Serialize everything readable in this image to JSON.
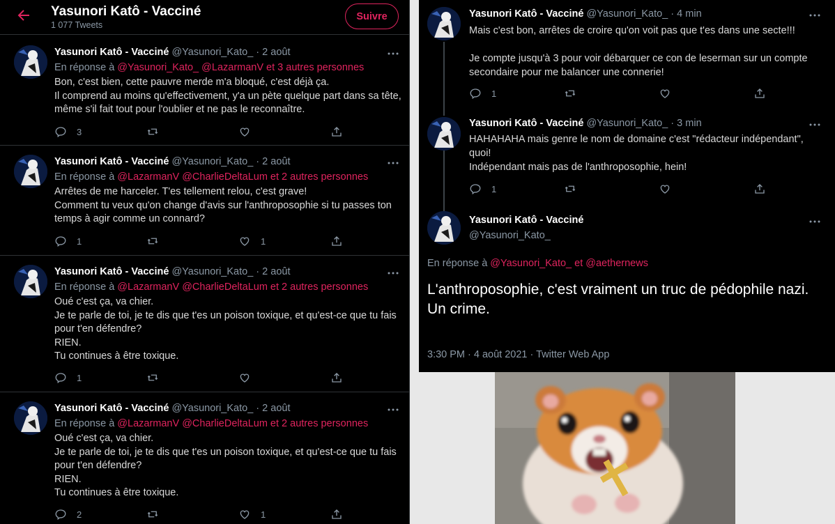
{
  "header": {
    "title": "Yasunori Katô - Vacciné",
    "tweet_count": "1 077 Tweets",
    "follow_label": "Suivre"
  },
  "left_tweets": [
    {
      "name": "Yasunori Katô - Vacciné",
      "handle": "@Yasunori_Kato_",
      "sep": " · ",
      "date": "2 août",
      "reply_prefix": "En réponse à ",
      "reply_mentions": "@Yasunori_Kato_ @LazarmanV  et 3 autres personnes",
      "text": "Bon, c'est bien, cette pauvre merde m'a bloqué, c'est déjà ça.\nIl comprend au moins qu'effectivement, y'a un pète quelque part dans sa tête, même s'il fait tout pour l'oublier et ne pas le reconnaître.",
      "replies": "3",
      "retweets": "",
      "likes": ""
    },
    {
      "name": "Yasunori Katô - Vacciné",
      "handle": "@Yasunori_Kato_",
      "sep": " · ",
      "date": "2 août",
      "reply_prefix": "En réponse à ",
      "reply_mentions": "@LazarmanV @CharlieDeltaLum  et 2 autres personnes",
      "text": "Arrêtes de me harceler. T'es tellement relou, c'est grave!\nComment tu veux qu'on change d'avis sur l'anthroposophie si tu passes ton temps à agir comme un connard?",
      "replies": "1",
      "retweets": "",
      "likes": "1"
    },
    {
      "name": "Yasunori Katô - Vacciné",
      "handle": "@Yasunori_Kato_",
      "sep": " · ",
      "date": "2 août",
      "reply_prefix": "En réponse à ",
      "reply_mentions": "@LazarmanV @CharlieDeltaLum  et 2 autres personnes",
      "text": "Oué c'est ça, va chier.\nJe te parle de toi, je te dis que t'es un poison toxique, et qu'est-ce que tu fais pour t'en défendre?\nRIEN.\nTu continues à être toxique.",
      "replies": "1",
      "retweets": "",
      "likes": ""
    },
    {
      "name": "Yasunori Katô - Vacciné",
      "handle": "@Yasunori_Kato_",
      "sep": " · ",
      "date": "2 août",
      "reply_prefix": "En réponse à ",
      "reply_mentions": "@LazarmanV @CharlieDeltaLum  et 2 autres personnes",
      "text": "Oué c'est ça, va chier.\nJe te parle de toi, je te dis que t'es un poison toxique, et qu'est-ce que tu fais pour t'en défendre?\nRIEN.\nTu continues à être toxique.",
      "replies": "2",
      "retweets": "",
      "likes": "1"
    }
  ],
  "right_tweets": [
    {
      "name": "Yasunori Katô - Vacciné",
      "handle": "@Yasunori_Kato_",
      "sep": " · ",
      "date": "4 min",
      "text": "Mais c'est bon, arrêtes de croire qu'on voit pas que t'es dans une secte!!!\n\nJe compte jusqu'à 3 pour voir débarquer ce con de leserman sur un compte secondaire pour me balancer une connerie!",
      "replies": "1"
    },
    {
      "name": "Yasunori Katô - Vacciné",
      "handle": "@Yasunori_Kato_",
      "sep": " · ",
      "date": "3 min",
      "text": "HAHAHAHA mais genre le nom de domaine c'est \"rédacteur indépendant\", quoi!\nIndépendant mais pas de l'anthroposophie, hein!",
      "replies": "1"
    }
  ],
  "main_tweet": {
    "name": "Yasunori Katô - Vacciné",
    "handle": "@Yasunori_Kato_",
    "reply_prefix": "En réponse à ",
    "reply_mentions": "@Yasunori_Kato_  et  @aethernews",
    "text": "L'anthroposophie, c'est vraiment un truc de pédophile nazi.\nUn crime.",
    "meta": "3:30 PM · 4 août 2021 · Twitter Web App"
  },
  "colors": {
    "accent": "#e0245e",
    "background": "#000000",
    "muted": "#8b98a5"
  },
  "icons": [
    "back-arrow-icon",
    "more-icon",
    "reply-icon",
    "retweet-icon",
    "like-icon",
    "share-icon"
  ]
}
